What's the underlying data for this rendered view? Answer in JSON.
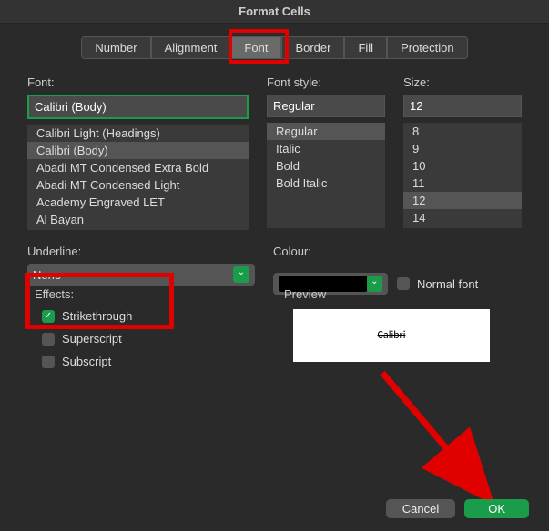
{
  "title": "Format Cells",
  "tabs": {
    "number": "Number",
    "alignment": "Alignment",
    "font": "Font",
    "border": "Border",
    "fill": "Fill",
    "protection": "Protection"
  },
  "font": {
    "label": "Font:",
    "value": "Calibri (Body)",
    "options": [
      "Calibri Light (Headings)",
      "Calibri (Body)",
      "Abadi MT Condensed Extra Bold",
      "Abadi MT Condensed Light",
      "Academy Engraved LET",
      "Al Bayan"
    ]
  },
  "style": {
    "label": "Font style:",
    "value": "Regular",
    "options": [
      "Regular",
      "Italic",
      "Bold",
      "Bold Italic"
    ]
  },
  "size": {
    "label": "Size:",
    "value": "12",
    "options": [
      "8",
      "9",
      "10",
      "11",
      "12",
      "14"
    ]
  },
  "underline": {
    "label": "Underline:",
    "value": "None"
  },
  "colour": {
    "label": "Colour:",
    "normal_label": "Normal font"
  },
  "effects": {
    "label": "Effects:",
    "strikethrough": "Strikethrough",
    "superscript": "Superscript",
    "subscript": "Subscript"
  },
  "preview": {
    "label": "Preview",
    "text": "Calibri"
  },
  "footer": {
    "cancel": "Cancel",
    "ok": "OK"
  }
}
